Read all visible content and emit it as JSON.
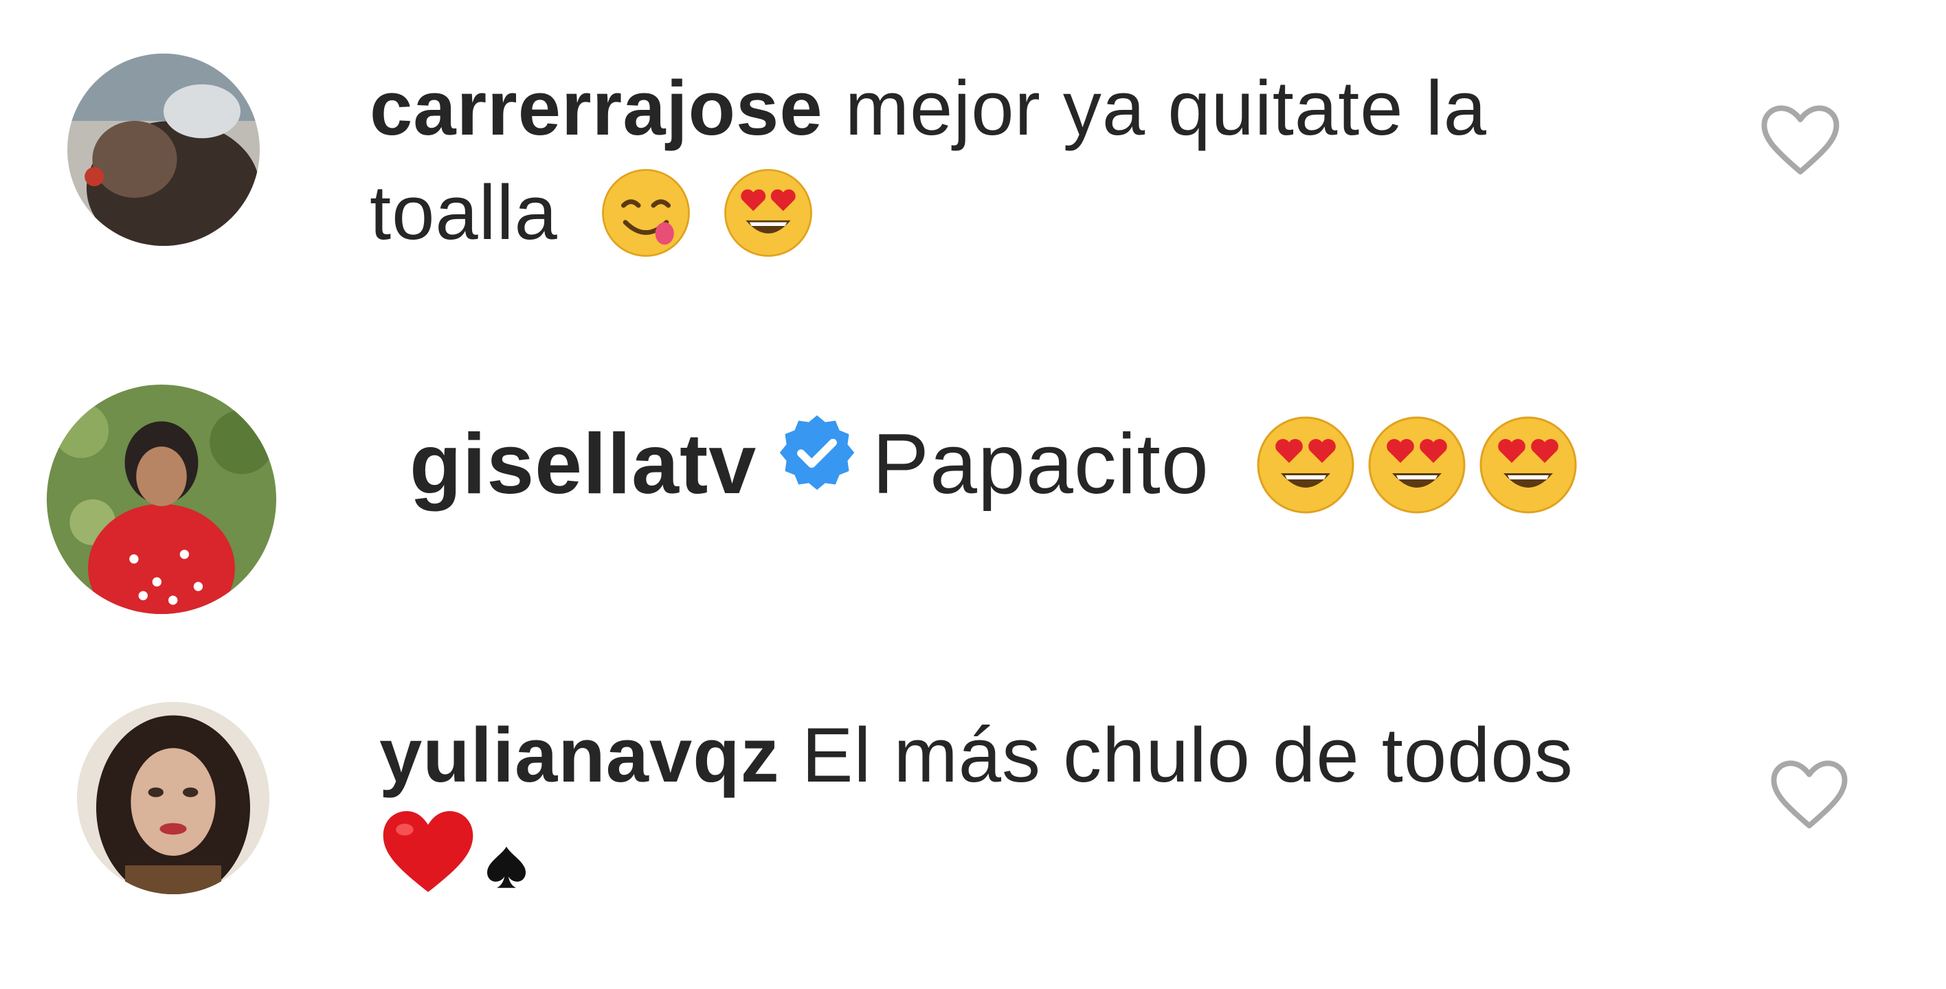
{
  "comments": [
    {
      "username": "carrerrajose",
      "text_line1": "mejor ya quitate la",
      "text_line2": "toalla",
      "emojis": [
        "yum-face-emoji",
        "heart-eyes-emoji"
      ],
      "liked": false
    },
    {
      "username": "gisellatv",
      "verified": true,
      "text_line1": "Papacito",
      "emojis": [
        "heart-eyes-emoji",
        "heart-eyes-emoji",
        "heart-eyes-emoji"
      ]
    },
    {
      "username": "yulianavqz",
      "text_line1": "El más chulo de todos",
      "emojis": [
        "red-heart-emoji",
        "spade-suit-emoji"
      ],
      "liked": false
    }
  ],
  "colors": {
    "text": "#262626",
    "verified_badge": "#3897f0",
    "heart_outline": "#a8a8a8"
  }
}
